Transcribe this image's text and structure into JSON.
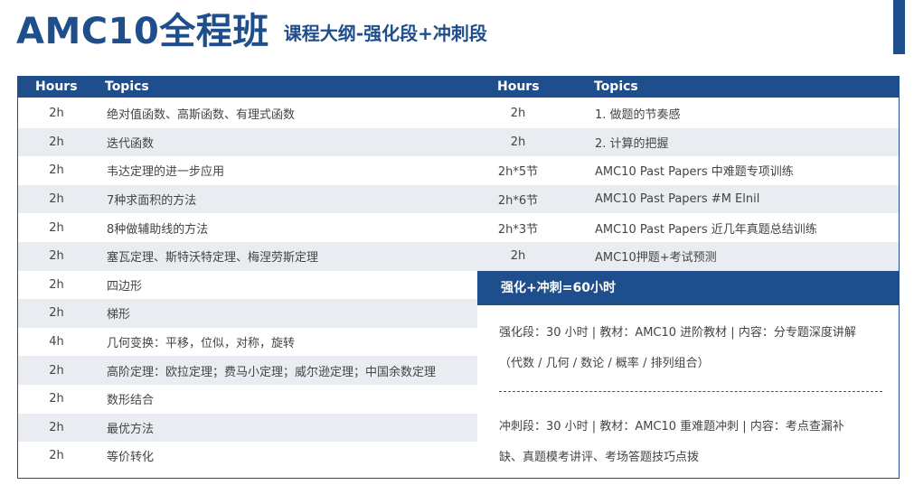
{
  "header": {
    "title": "AMC10全程班",
    "subtitle": "课程大纲-强化段+冲刺段"
  },
  "table_headers": {
    "hours": "Hours",
    "topics": "Topics"
  },
  "left_rows": [
    {
      "hours": "2h",
      "topic": "绝对值函数、高斯函数、有理式函数"
    },
    {
      "hours": "2h",
      "topic": "迭代函数"
    },
    {
      "hours": "2h",
      "topic": "韦达定理的进一步应用"
    },
    {
      "hours": "2h",
      "topic": "7种求面积的方法"
    },
    {
      "hours": "2h",
      "topic": "8种做辅助线的方法"
    },
    {
      "hours": "2h",
      "topic": "塞瓦定理、斯特沃特定理、梅涅劳斯定理"
    },
    {
      "hours": "2h",
      "topic": "四边形"
    },
    {
      "hours": "2h",
      "topic": "梯形"
    },
    {
      "hours": "4h",
      "topic": "几何变换：平移，位似，对称，旋转"
    },
    {
      "hours": "2h",
      "topic": "高阶定理：欧拉定理；费马小定理；威尔逊定理；中国余数定理"
    },
    {
      "hours": "2h",
      "topic": "数形结合"
    },
    {
      "hours": "2h",
      "topic": "最优方法"
    },
    {
      "hours": "2h",
      "topic": "等价转化"
    }
  ],
  "right_rows": [
    {
      "hours": "2h",
      "topic": "1. 做题的节奏感"
    },
    {
      "hours": "2h",
      "topic": "2. 计算的把握"
    },
    {
      "hours": "2h*5节",
      "topic": "AMC10 Past Papers 中难题专项训练"
    },
    {
      "hours": "2h*6节",
      "topic": "AMC10 Past Papers #M Elnil"
    },
    {
      "hours": "2h*3节",
      "topic": "AMC10 Past Papers 近几年真题总结训练"
    },
    {
      "hours": "2h",
      "topic": "AMC10押题+考试预测"
    }
  ],
  "summary": {
    "heading": "强化+冲刺=60小时",
    "line1": "强化段：30 小时 | 教材：AMC10 进阶教材 | 内容：分专题深度讲解",
    "line2": "（代数 / 几何 / 数论 / 概率 / 排列组合）",
    "line3": "冲刺段：30 小时 | 教材：AMC10 重难题冲刺 | 内容：考点查漏补",
    "line4": "缺、真题模考讲评、考场答题技巧点拨"
  },
  "colors": {
    "brand_blue": "#1f4e8c",
    "row_stripe": "#e9ecf1"
  }
}
